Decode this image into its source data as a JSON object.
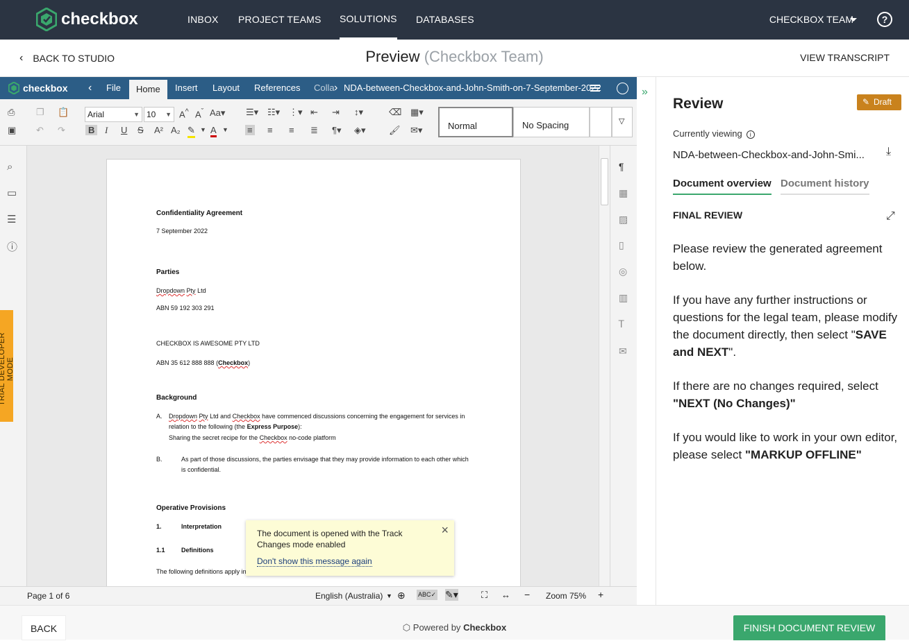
{
  "nav": {
    "brand": "checkbox",
    "items": [
      "INBOX",
      "PROJECT TEAMS",
      "SOLUTIONS",
      "DATABASES"
    ],
    "active": "SOLUTIONS",
    "team": "CHECKBOX TEAM",
    "help": "?"
  },
  "subheader": {
    "back": "BACK TO STUDIO",
    "title": "Preview",
    "title_muted": "(Checkbox Team)",
    "view_transcript": "VIEW TRANSCRIPT"
  },
  "editor": {
    "brand": "checkbox",
    "tabs": [
      "File",
      "Home",
      "Insert",
      "Layout",
      "References",
      "Colla"
    ],
    "active_tab": "Home",
    "document_name": "NDA-between-Checkbox-and-John-Smith-on-7-September-2022",
    "font": "Arial",
    "font_size": "10",
    "styles": [
      "Normal",
      "No Spacing"
    ],
    "trial_label": "TRIAL DEVELOPER MODE"
  },
  "document": {
    "title": "Confidentiality Agreement",
    "date": "7 September 2022",
    "parties_heading": "Parties",
    "party1_name_a": "Dropdown",
    "party1_name_b": "Pty",
    "party1_name_c": "Ltd",
    "party1_abn": "ABN 59 192 303 291",
    "party2_name": "CHECKBOX IS AWESOME PTY LTD",
    "party2_abn": "ABN 35 612 888 888 (",
    "party2_short": "Checkbox",
    "party2_close": ")",
    "background_heading": "Background",
    "bg_a_label": "A.",
    "bg_a_line1_a": "Dropdown",
    "bg_a_line1_b": "Pty",
    "bg_a_line1_c": "Ltd and",
    "bg_a_line1_d": "Checkbox",
    "bg_a_line1_e": "have commenced discussions concerning the engagement for services in",
    "bg_a_line2_a": "relation to the following (the",
    "bg_a_line2_b": "Express Purpose",
    "bg_a_line2_c": "):",
    "bg_a_line3_a": "Sharing the secret recipe for the",
    "bg_a_line3_b": "Checkbox",
    "bg_a_line3_c": "no-code platform",
    "bg_b_label": "B.",
    "bg_b_line1": "As part of those discussions, the parties envisage that they may provide information to each other which",
    "bg_b_line2": "is confidential.",
    "operative_heading": "Operative Provisions",
    "s1_num": "1.",
    "s1_title": "Interpretation",
    "s11_num": "1.1",
    "s11_title": "Definitions",
    "definitions_intro": "The following definitions apply in"
  },
  "toast": {
    "message": "The document is opened with the Track Changes mode enabled",
    "link": "Don't show this message again",
    "close": "×"
  },
  "status": {
    "page": "Page 1 of 6",
    "language": "English (Australia)",
    "zoom": "Zoom 75%"
  },
  "review": {
    "title": "Review",
    "badge": "Draft",
    "currently_viewing": "Currently viewing",
    "file": "NDA-between-Checkbox-and-John-Smi...",
    "tab_overview": "Document overview",
    "tab_history": "Document history",
    "section": "FINAL REVIEW",
    "p1": "Please review the generated agreement below.",
    "p2_a": "If you have any further instructions or questions for the legal team, please modify the document directly, then select \"",
    "p2_b": "SAVE and NEXT",
    "p2_c": "\".",
    "p3_a": "If there are no changes required, select",
    "p3_b": "\"NEXT (No Changes)\"",
    "p4_a": "If you would like to work in your own editor, please select",
    "p4_b": "\"MARKUP OFFLINE\""
  },
  "footer": {
    "back": "BACK",
    "powered_a": "Powered by",
    "powered_b": "Checkbox",
    "finish": "FINISH DOCUMENT REVIEW"
  },
  "colors": {
    "nav_bg": "#2b3442",
    "editor_bar": "#2c5d86",
    "accent_green": "#3aa76d",
    "draft_badge": "#c9821d",
    "trial_banner": "#f5a623",
    "toast_bg": "#fdfcd6"
  }
}
